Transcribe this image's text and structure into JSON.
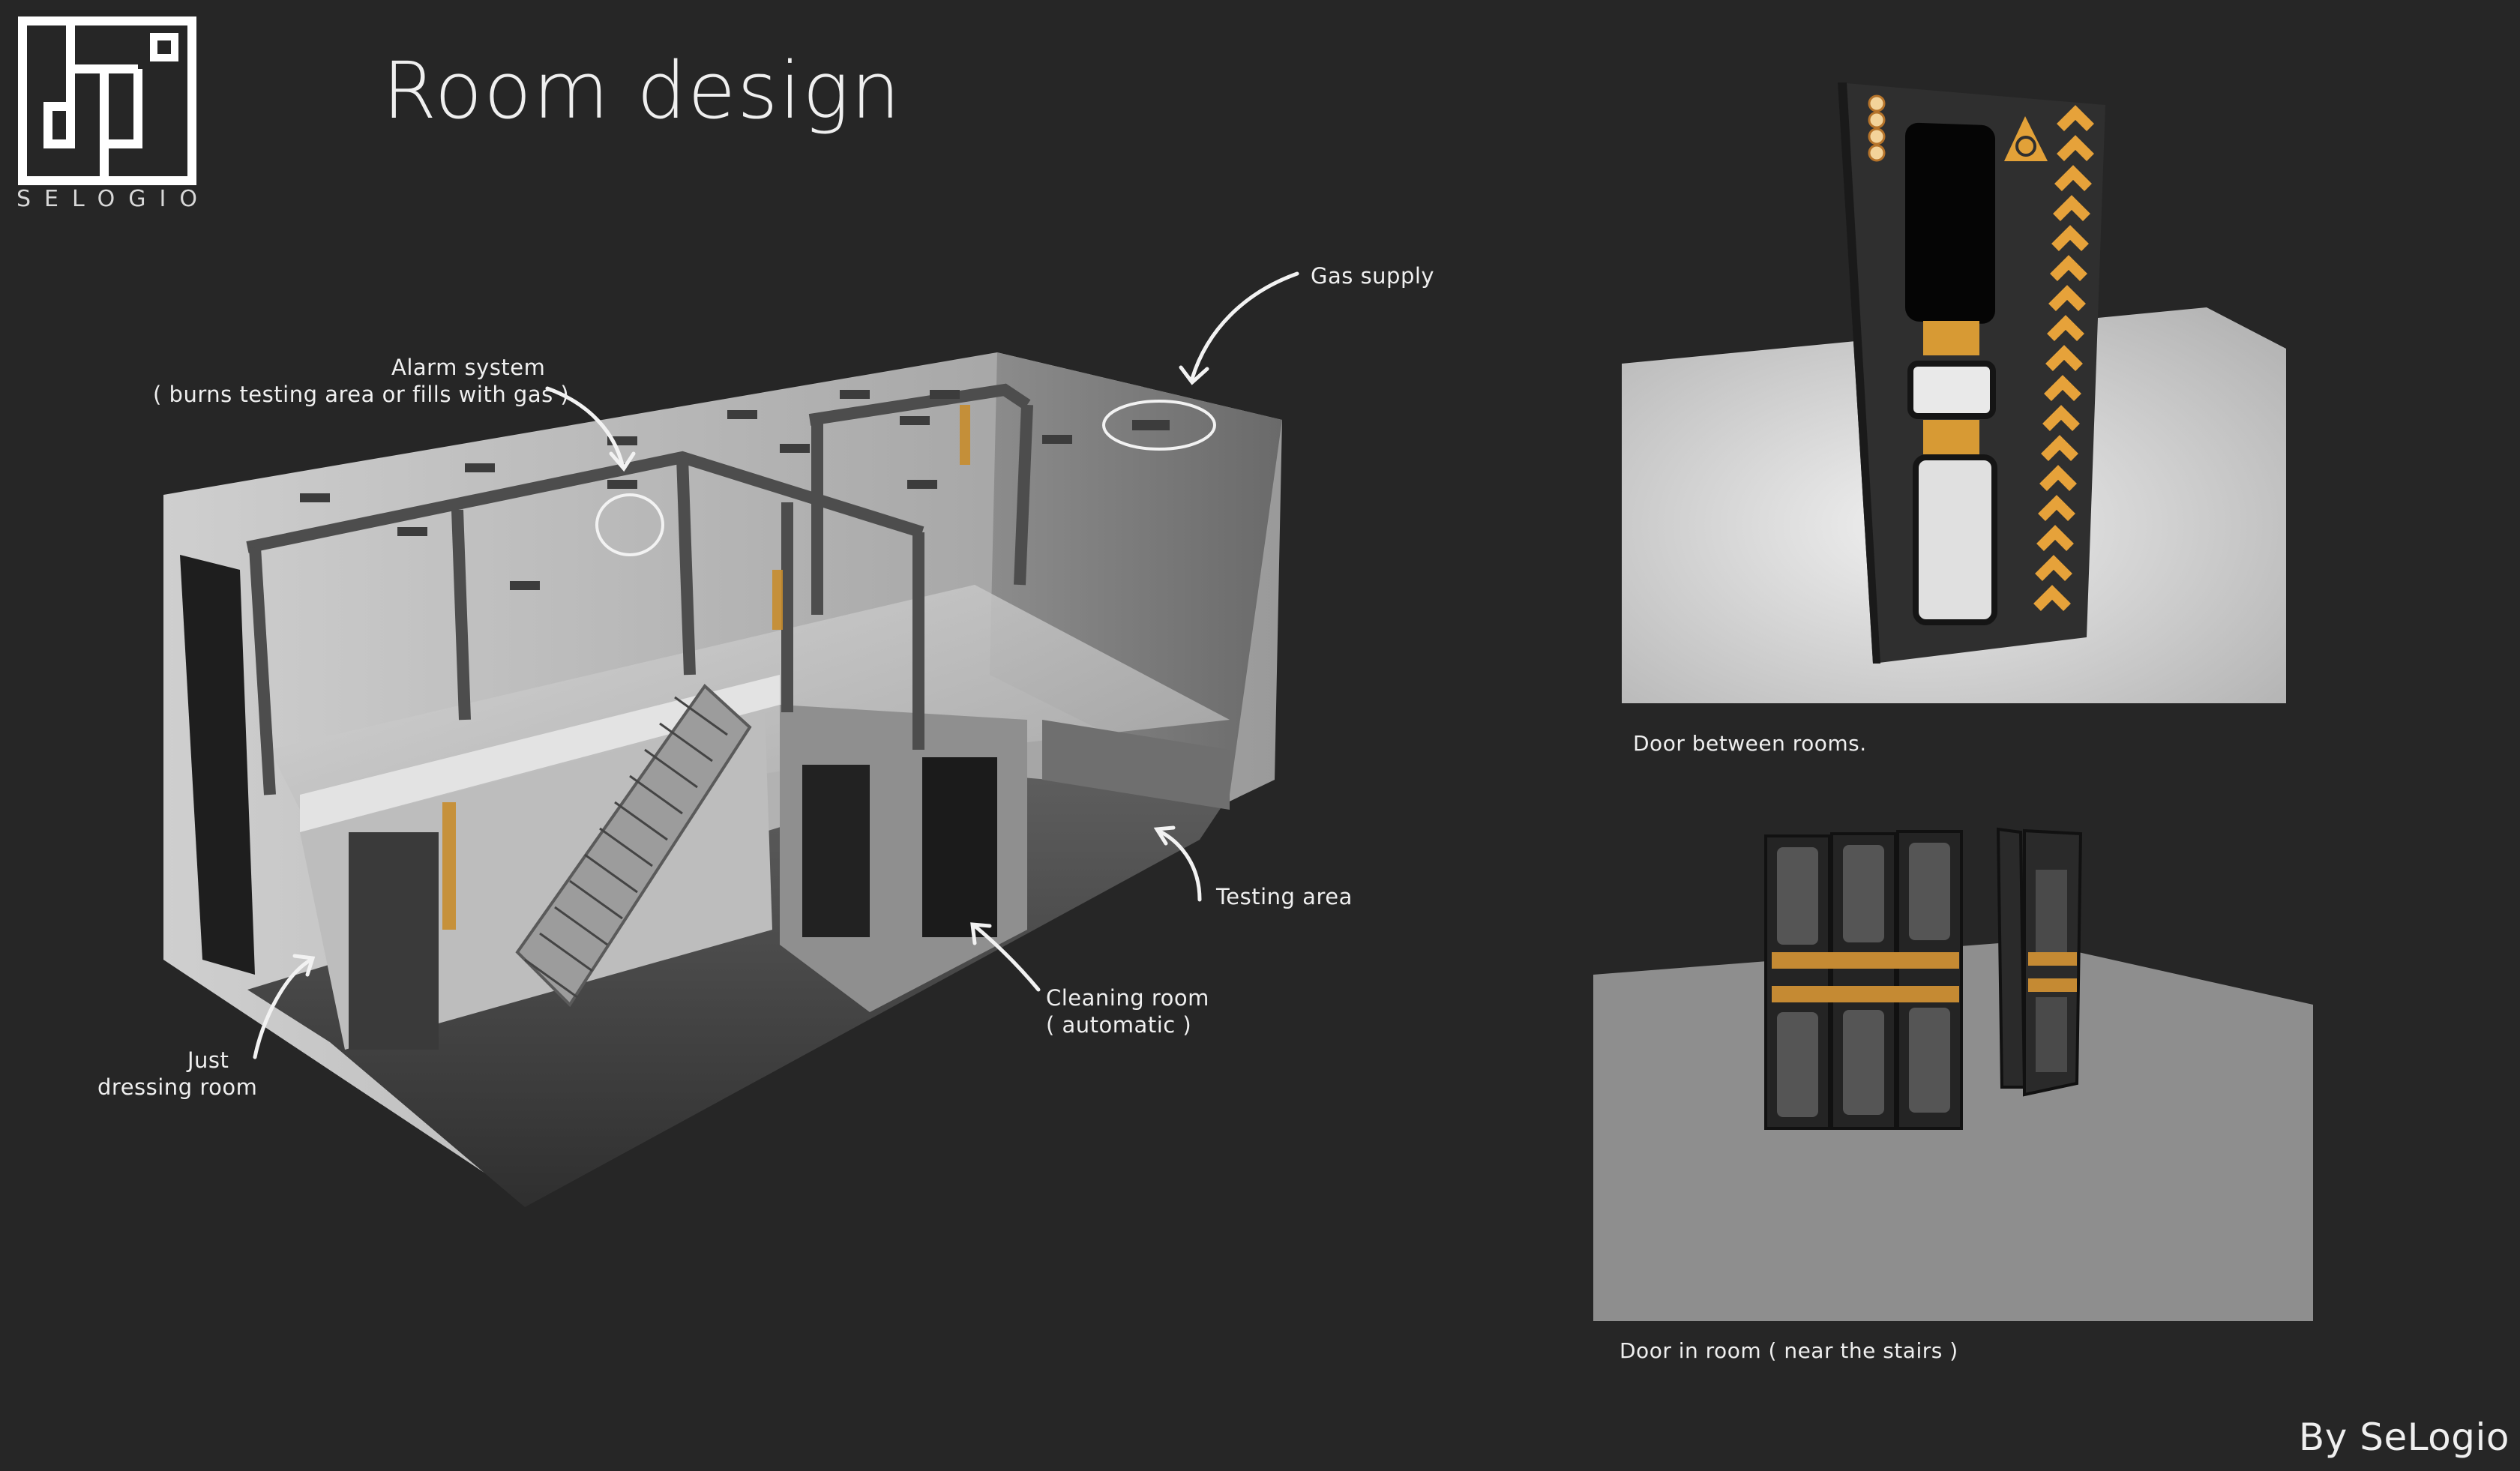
{
  "title": "Room design",
  "brand": {
    "name": "SELOGIO"
  },
  "annotations": {
    "gas_supply": "Gas supply",
    "alarm_line1": "Alarm system",
    "alarm_line2": "( burns testing area or fills with gas )",
    "testing_area": "Testing area",
    "cleaning_line1": "Cleaning room",
    "cleaning_line2": "( automatic )",
    "dressing_line1": "Just",
    "dressing_line2": "dressing room"
  },
  "captions": {
    "door_between": "Door between rooms.",
    "door_in_room": "Door in room ( near the stairs )"
  },
  "credit": "By SeLogio",
  "colors": {
    "background": "#262626",
    "accent_orange": "#e8a23a",
    "annotation": "#efefef"
  }
}
